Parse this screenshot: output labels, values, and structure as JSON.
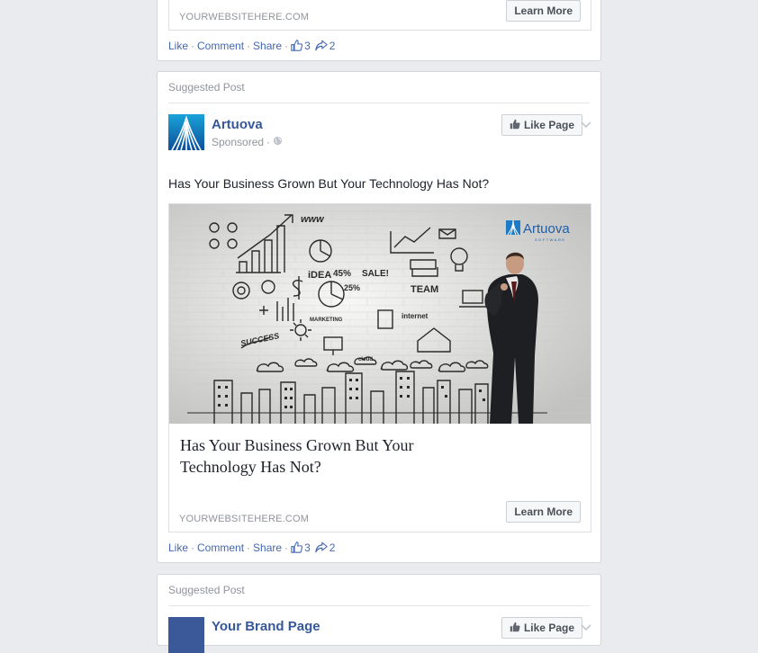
{
  "post1": {
    "site": "YOURWEBSITEHERE.COM",
    "learn_more": "Learn More",
    "actions": {
      "like": "Like",
      "comment": "Comment",
      "share": "Share",
      "likes": "3",
      "shares": "2",
      "sep": "·"
    }
  },
  "post2": {
    "suggested": "Suggested Post",
    "page_name": "Artuova",
    "sponsored": "Sponsored",
    "sponsored_sep": "·",
    "like_page": "Like Page",
    "text": "Has Your Business Grown But Your Technology Has Not?",
    "image": {
      "brand": "Artuova",
      "brand_sub": "SOFTWARE",
      "doodles": [
        "www",
        "iDEA",
        "45%",
        "SALE!",
        "TEAM",
        "25%",
        "internet",
        "MARKETING",
        "cloud",
        "SUCCESS"
      ]
    },
    "headline": "Has Your Business Grown But Your Technology Has Not?",
    "site": "YOURWEBSITEHERE.COM",
    "learn_more": "Learn More",
    "actions": {
      "like": "Like",
      "comment": "Comment",
      "share": "Share",
      "likes": "3",
      "shares": "2",
      "sep": "·"
    }
  },
  "post3": {
    "suggested": "Suggested Post",
    "page_name": "Your Brand Page",
    "like_page": "Like Page"
  },
  "colors": {
    "link": "#4267b2",
    "page_name": "#365899",
    "background": "#e9ebee",
    "logo_blue": "#3b5998"
  },
  "icons": [
    "thumbs-up-icon",
    "share-arrow-icon",
    "globe-icon",
    "chevron-down-icon"
  ]
}
